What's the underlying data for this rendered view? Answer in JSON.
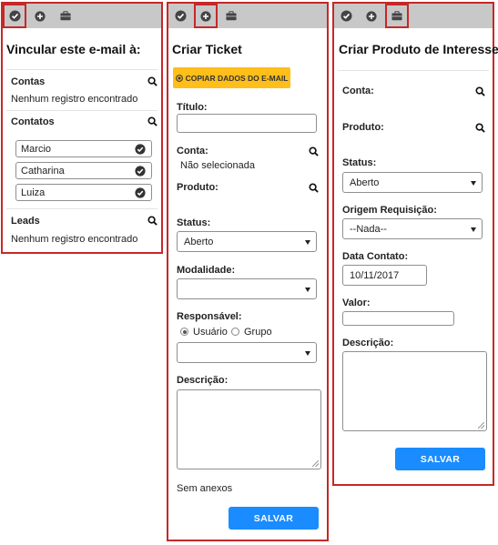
{
  "panel1": {
    "title": "Vincular este e-mail à:",
    "contas": {
      "heading": "Contas",
      "empty": "Nenhum registro encontrado"
    },
    "contatos": {
      "heading": "Contatos",
      "items": [
        "Marcio",
        "Catharina",
        "Luiza"
      ]
    },
    "leads": {
      "heading": "Leads",
      "empty": "Nenhum registro encontrado"
    }
  },
  "panel2": {
    "title": "Criar Ticket",
    "copy_button": "COPIAR DADOS DO E-MAIL",
    "titulo_label": "Título:",
    "titulo_value": "",
    "conta_label": "Conta:",
    "conta_value": "Não selecionada",
    "produto_label": "Produto:",
    "status_label": "Status:",
    "status_value": "Aberto",
    "modalidade_label": "Modalidade:",
    "modalidade_value": "",
    "responsavel_label": "Responsável:",
    "radio_usuario": "Usuário",
    "radio_grupo": "Grupo",
    "responsavel_value": "",
    "descricao_label": "Descrição:",
    "anexos": "Sem anexos",
    "save": "SALVAR"
  },
  "panel3": {
    "title": "Criar Produto de Interesse",
    "conta_label": "Conta:",
    "produto_label": "Produto:",
    "status_label": "Status:",
    "status_value": "Aberto",
    "origem_label": "Origem Requisição:",
    "origem_value": "--Nada--",
    "data_label": "Data Contato:",
    "data_value": "10/11/2017",
    "valor_label": "Valor:",
    "valor_value": "",
    "descricao_label": "Descrição:",
    "save": "SALVAR"
  },
  "colors": {
    "accent_red": "#c62828",
    "toolbar_gray": "#c8c8c8",
    "save_blue": "#1a8cff",
    "copy_yellow": "#ffbe1a"
  },
  "icons": [
    "check-circle-icon",
    "plus-circle-icon",
    "briefcase-icon",
    "search-icon",
    "check-circle-icon",
    "chevron-down-icon",
    "copy-icon"
  ]
}
